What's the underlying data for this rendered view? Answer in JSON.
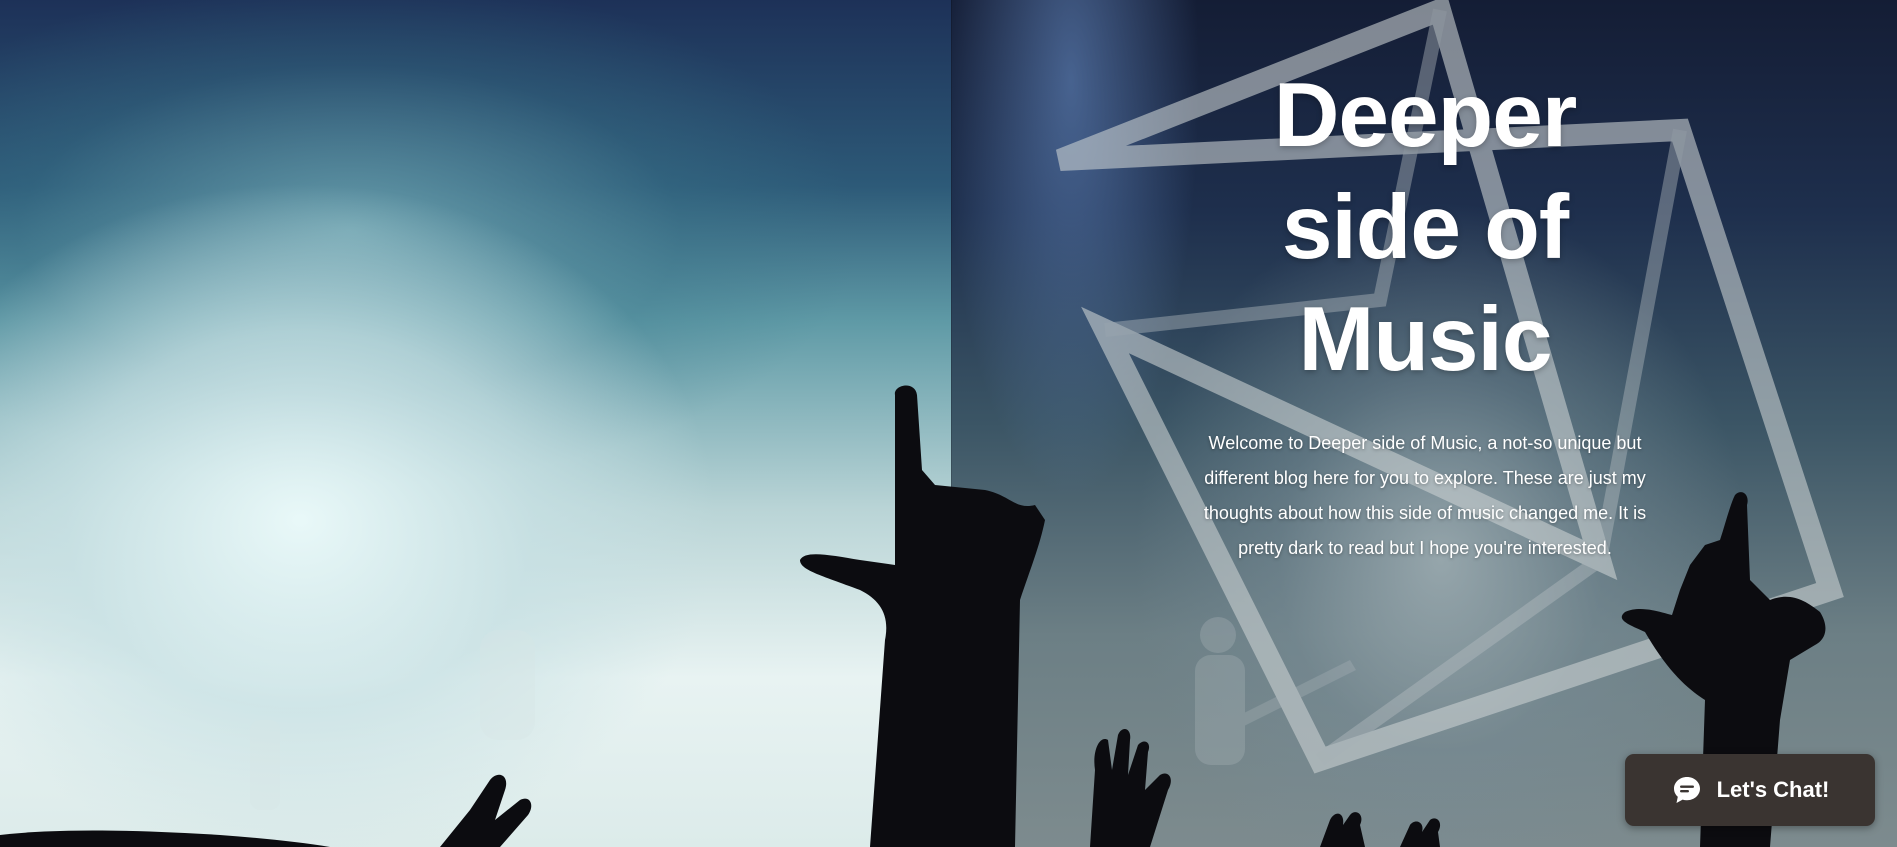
{
  "hero": {
    "title_lines": [
      "Deeper",
      "side of",
      "Music"
    ],
    "intro": "Welcome to Deeper side of Music, a not-so unique but different blog here for you to explore. These are just my thoughts about how this side of music changed me. It is pretty dark to read but I hope you're interested."
  },
  "chat_widget": {
    "label": "Let's Chat!",
    "icon": "chat-bubble-icon",
    "background_color": "#3a3431"
  },
  "colors": {
    "title_text": "#ffffff",
    "body_text": "#ffffff"
  }
}
